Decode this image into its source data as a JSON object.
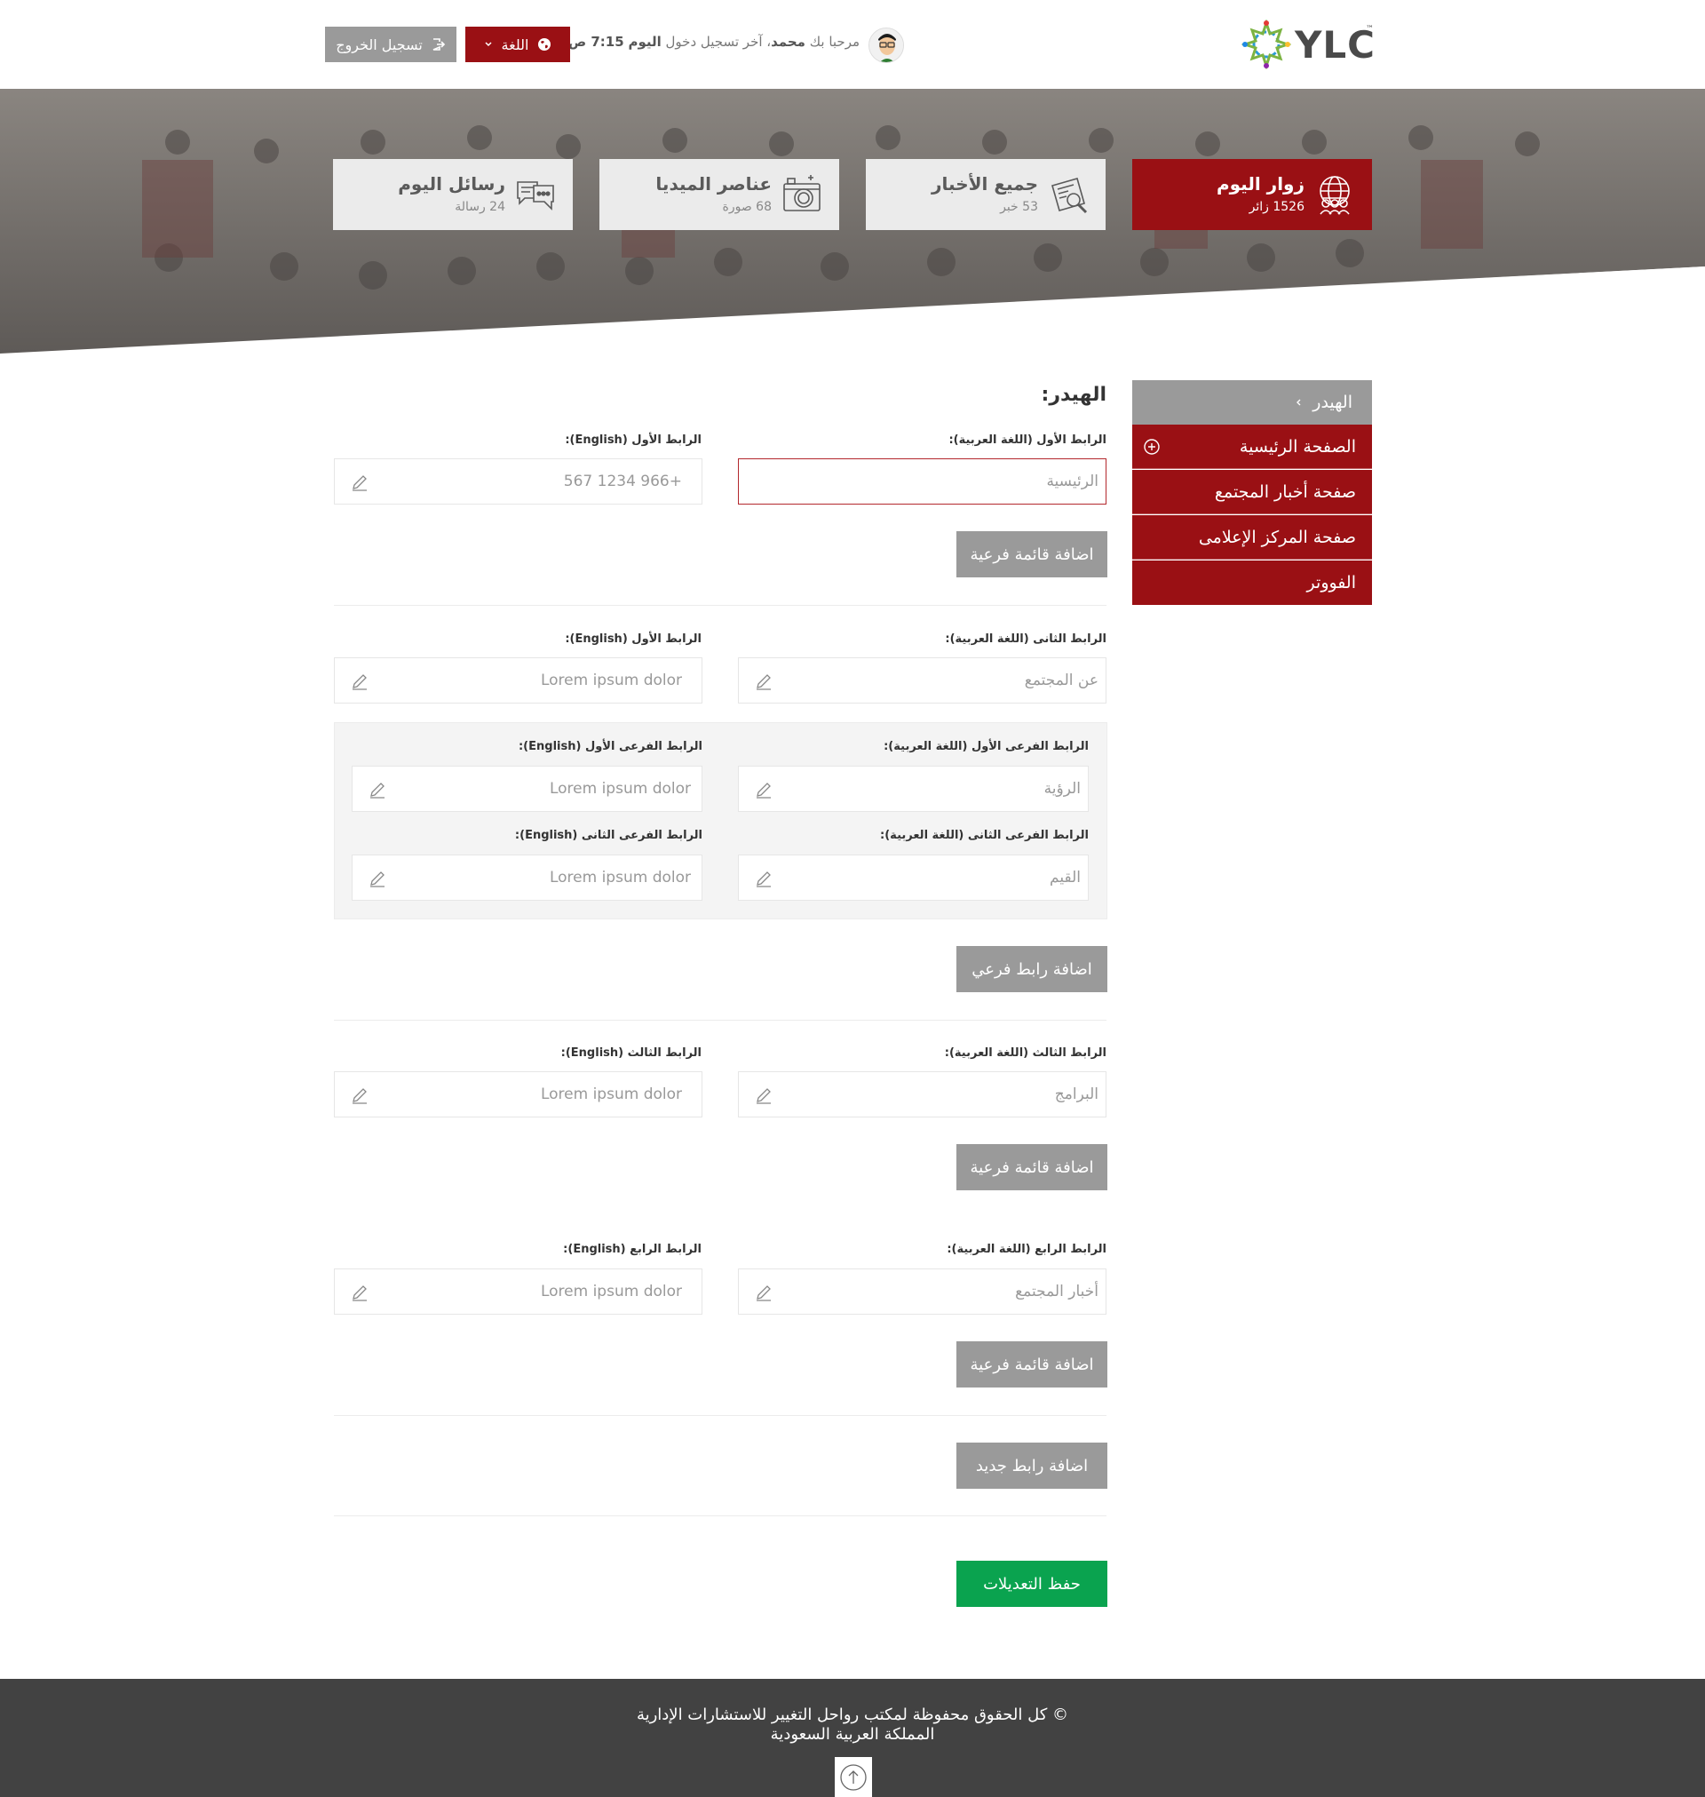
{
  "header": {
    "logo_text": "YLC",
    "logo_tm": "™",
    "welcome_prefix": "مرحبا بك",
    "user_name": "محمد",
    "last_login_label": "، آخر تسجيل دخول",
    "last_login_day": "اليوم",
    "last_login_time": "7:15 ص",
    "language_label": "اللغة",
    "logout_label": "تسجيل الخروج"
  },
  "stats": [
    {
      "title": "زوار اليوم",
      "sub": "1526 زائر",
      "icon": "globe-people-icon",
      "active": true
    },
    {
      "title": "جميع الأخبار",
      "sub": "53 خبر",
      "icon": "news-search-icon",
      "active": false
    },
    {
      "title": "عناصر الميديا",
      "sub": "68 صورة",
      "icon": "camera-icon",
      "active": false
    },
    {
      "title": "رسائل اليوم",
      "sub": "24 رسالة",
      "icon": "chat-bubbles-icon",
      "active": false
    }
  ],
  "sidebar": {
    "head": "الهيدر",
    "items": [
      "الصفحة الرئيسية",
      "صفحة أخبار المجتمع",
      "صفحة المركز الإعلامى",
      "الفووتر"
    ]
  },
  "form": {
    "section_title": "الهيدر:",
    "link1": {
      "label_ar": "الرابط الأول (اللغة العربية):",
      "label_en": "الرابط الأول (English):",
      "value_ar": "الرئيسية",
      "value_en": "+966 1234 567",
      "add_sub_menu": "اضافة قائمة فرعية"
    },
    "link2": {
      "label_ar": "الرابط الثانى (اللغة العربية):",
      "label_en": "الرابط الأول (English):",
      "value_ar": "عن المجتمع",
      "value_en": "Lorem ipsum dolor",
      "sub1_label_ar": "الرابط الفرعى الأول (اللغة العربية):",
      "sub1_label_en": "الرابط الفرعى الأول (English):",
      "sub1_value_ar": "الرؤية",
      "sub1_value_en": "Lorem ipsum dolor",
      "sub2_label_ar": "الرابط الفرعى الثانى (اللغة العربية):",
      "sub2_label_en": "الرابط الفرعى الثانى (English):",
      "sub2_value_ar": "القيم",
      "sub2_value_en": "Lorem ipsum dolor",
      "add_sub_link": "اضافة رابط فرعي"
    },
    "link3": {
      "label_ar": "الرابط الثالث (اللغة العربية):",
      "label_en": "الرابط الثالث (English):",
      "value_ar": "البرامج",
      "value_en": "Lorem ipsum dolor",
      "add_sub_menu": "اضافة قائمة فرعية"
    },
    "link4": {
      "label_ar": "الرابط الرابع (اللغة العربية):",
      "label_en": "الرابط الرابع (English):",
      "value_ar": "أخبار المجتمع",
      "value_en": "Lorem ipsum dolor",
      "add_sub_menu": "اضافة قائمة فرعية"
    },
    "add_new_link": "اضافة رابط جديد",
    "save_changes": "حفظ التعديلات"
  },
  "footer": {
    "line1": "© كل الحقوق محفوظة لمكتب رواحل التغيير للاستشارات الإدارية",
    "line2": "المملكة العربية السعودية"
  },
  "colors": {
    "brand_red": "#9a1014",
    "gray_button": "#9a9a9a",
    "save_green": "#0aa34f",
    "footer_bg": "#424242"
  }
}
